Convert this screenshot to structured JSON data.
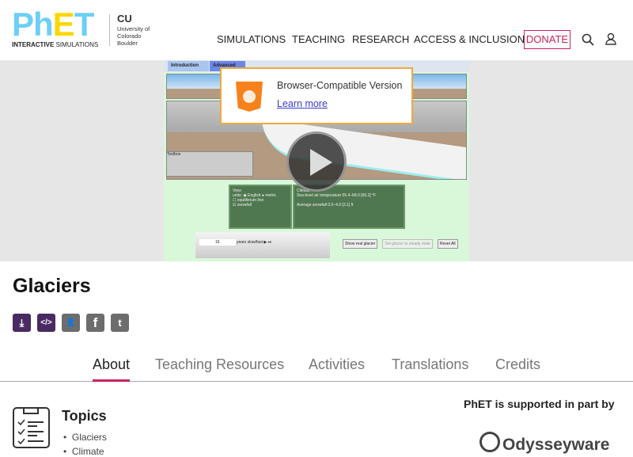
{
  "header": {
    "logo_text": "PhET",
    "logo_sub_bold": "INTERACTIVE",
    "logo_sub": "SIMULATIONS",
    "partner": "University of Colorado Boulder",
    "nav": [
      "SIMULATIONS",
      "TEACHING",
      "RESEARCH",
      "ACCESS & INCLUSION"
    ],
    "donate": "DONATE",
    "icons": [
      "search-icon",
      "user-icon"
    ]
  },
  "sim": {
    "tabs": [
      "Introduction",
      "Advanced"
    ],
    "toolbox": "Toolbox",
    "view": {
      "title": "View",
      "units": "units:",
      "english": "English",
      "metric": "metric",
      "equilibrium": "equilibrium line",
      "snowfall": "snowfall"
    },
    "climate": {
      "title": "Climate",
      "temp_label": "Sea-level air temperature",
      "temp_min": "55.4",
      "temp_max": "68.0",
      "temp_value": "66.2",
      "temp_unit": "°F",
      "snow_label": "Average snowfall",
      "snow_min": "0.0",
      "snow_max": "4.9",
      "snow_value": "3.1",
      "snow_unit": "ft"
    },
    "years": "16",
    "years_label": "years",
    "slow": "slow",
    "fast": "fast",
    "buttons": [
      "Show real glacier",
      "Set glacier to steady state",
      "Reset All"
    ]
  },
  "popup": {
    "title": "Browser-Compatible Version",
    "link": "Learn more"
  },
  "page_title": "Glaciers",
  "action_icons": [
    "download-icon",
    "embed-icon",
    "classroom-icon",
    "facebook-icon",
    "twitter-icon"
  ],
  "tabs": [
    "About",
    "Teaching Resources",
    "Activities",
    "Translations",
    "Credits"
  ],
  "topics": {
    "title": "Topics",
    "items": [
      "Glaciers",
      "Climate"
    ]
  },
  "support": {
    "text": "PhET is supported in part by",
    "sponsor": "Odysseyware"
  },
  "colors": {
    "accent": "#c9235e",
    "purple": "#4a2a63",
    "gray": "#6d6d6d"
  }
}
